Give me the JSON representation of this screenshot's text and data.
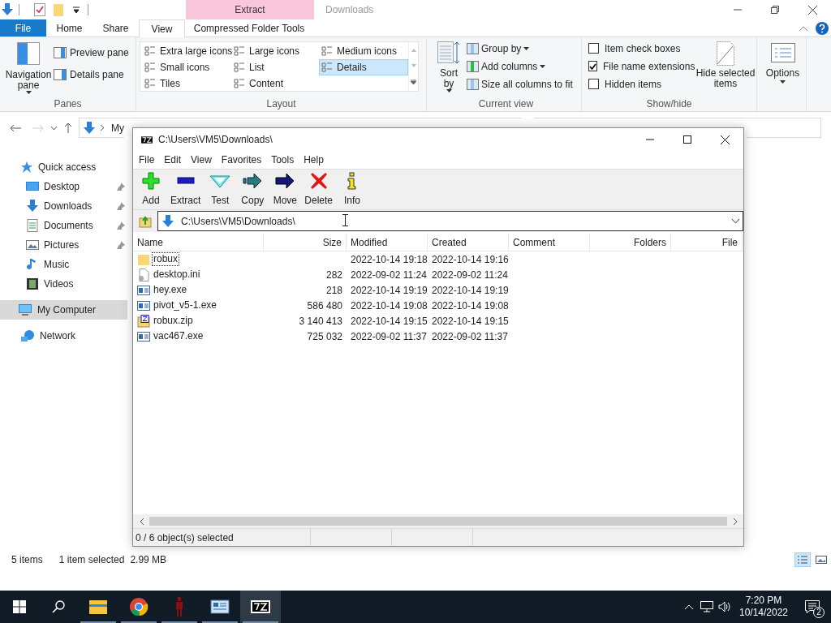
{
  "explorer": {
    "contextual_tab": "Extract",
    "title": "Downloads",
    "tabs": [
      {
        "label": "File",
        "kind": "file",
        "selected": false
      },
      {
        "label": "Home",
        "kind": "tab",
        "selected": false
      },
      {
        "label": "Share",
        "kind": "tab",
        "selected": false
      },
      {
        "label": "View",
        "kind": "tab",
        "selected": true
      },
      {
        "label": "Compressed Folder Tools",
        "kind": "contextual",
        "selected": false
      }
    ],
    "ribbon": {
      "panes": {
        "label": "Panes",
        "navigation_pane": "Navigation pane",
        "items": [
          "Preview pane",
          "Details pane"
        ]
      },
      "layout": {
        "label": "Layout",
        "options": [
          {
            "label": "Extra large icons",
            "selected": false
          },
          {
            "label": "Large icons",
            "selected": false
          },
          {
            "label": "Medium icons",
            "selected": false
          },
          {
            "label": "Small icons",
            "selected": false
          },
          {
            "label": "List",
            "selected": false
          },
          {
            "label": "Details",
            "selected": true
          },
          {
            "label": "Tiles",
            "selected": false
          },
          {
            "label": "Content",
            "selected": false
          }
        ]
      },
      "current_view": {
        "label": "Current view",
        "sort_by": "Sort by",
        "items": [
          {
            "label": "Group by",
            "dropdown": true
          },
          {
            "label": "Add columns",
            "dropdown": true
          },
          {
            "label": "Size all columns to fit",
            "dropdown": false
          }
        ]
      },
      "show_hide": {
        "label": "Show/hide",
        "checkboxes": [
          {
            "label": "Item check boxes",
            "checked": false
          },
          {
            "label": "File name extensions",
            "checked": true
          },
          {
            "label": "Hidden items",
            "checked": false
          }
        ],
        "hide_selected": "Hide selected items"
      },
      "options": "Options"
    },
    "address": {
      "crumbs": [
        "My"
      ]
    },
    "navigation": [
      {
        "label": "Quick access",
        "kind": "star",
        "selected": false,
        "children": [
          {
            "label": "Desktop",
            "kind": "desktop",
            "pinned": true,
            "selected": false
          },
          {
            "label": "Downloads",
            "kind": "download",
            "pinned": true,
            "selected": false
          },
          {
            "label": "Documents",
            "kind": "document",
            "pinned": true,
            "selected": false
          },
          {
            "label": "Pictures",
            "kind": "pictures",
            "pinned": true,
            "selected": false
          },
          {
            "label": "Music",
            "kind": "music",
            "pinned": false,
            "selected": false
          },
          {
            "label": "Videos",
            "kind": "videos",
            "pinned": false,
            "selected": false
          }
        ]
      },
      {
        "label": "My Computer",
        "kind": "computer",
        "selected": true
      },
      {
        "label": "Network",
        "kind": "network",
        "selected": false
      }
    ],
    "status": {
      "count": "5 items",
      "selection": "1 item selected",
      "size": "2.99 MB"
    }
  },
  "sevenzip": {
    "title": "C:\\Users\\VM5\\Downloads\\",
    "menu": [
      "File",
      "Edit",
      "View",
      "Favorites",
      "Tools",
      "Help"
    ],
    "toolbar": [
      {
        "label": "Add",
        "kind": "add"
      },
      {
        "label": "Extract",
        "kind": "extract"
      },
      {
        "label": "Test",
        "kind": "test"
      },
      {
        "label": "Copy",
        "kind": "copy"
      },
      {
        "label": "Move",
        "kind": "move"
      },
      {
        "label": "Delete",
        "kind": "delete"
      },
      {
        "label": "Info",
        "kind": "info"
      }
    ],
    "address": "C:\\Users\\VM5\\Downloads\\",
    "columns": [
      "Name",
      "Size",
      "Modified",
      "Created",
      "Comment",
      "Folders",
      "File"
    ],
    "rows": [
      {
        "kind": "folder",
        "focused": true,
        "name": "robux",
        "size": "",
        "modified": "2022-10-14 19:18",
        "created": "2022-10-14 19:16"
      },
      {
        "kind": "settings",
        "focused": false,
        "name": "desktop.ini",
        "size": "282",
        "modified": "2022-09-02 11:24",
        "created": "2022-09-02 11:24"
      },
      {
        "kind": "exe",
        "focused": false,
        "name": "hey.exe",
        "size": "218",
        "modified": "2022-10-14 19:19",
        "created": "2022-10-14 19:19"
      },
      {
        "kind": "exe",
        "focused": false,
        "name": "pivot_v5-1.exe",
        "size": "586 480",
        "modified": "2022-10-14 19:08",
        "created": "2022-10-14 19:08"
      },
      {
        "kind": "zip",
        "focused": false,
        "name": "robux.zip",
        "size": "3 140 413",
        "modified": "2022-10-14 19:15",
        "created": "2022-10-14 19:15"
      },
      {
        "kind": "exe",
        "focused": false,
        "name": "vac467.exe",
        "size": "725 032",
        "modified": "2022-09-02 11:37",
        "created": "2022-09-02 11:37"
      }
    ],
    "status": "0 / 6 object(s) selected"
  },
  "taskbar": {
    "apps": [
      {
        "kind": "folder",
        "running": true,
        "active": false
      },
      {
        "kind": "chrome",
        "running": true,
        "active": false
      },
      {
        "kind": "red",
        "running": true,
        "active": false
      },
      {
        "kind": "monitor",
        "running": true,
        "active": false
      },
      {
        "kind": "sevenzip",
        "running": true,
        "active": true
      }
    ],
    "time": "7:20 PM",
    "date": "10/14/2022",
    "notifications": "2"
  }
}
